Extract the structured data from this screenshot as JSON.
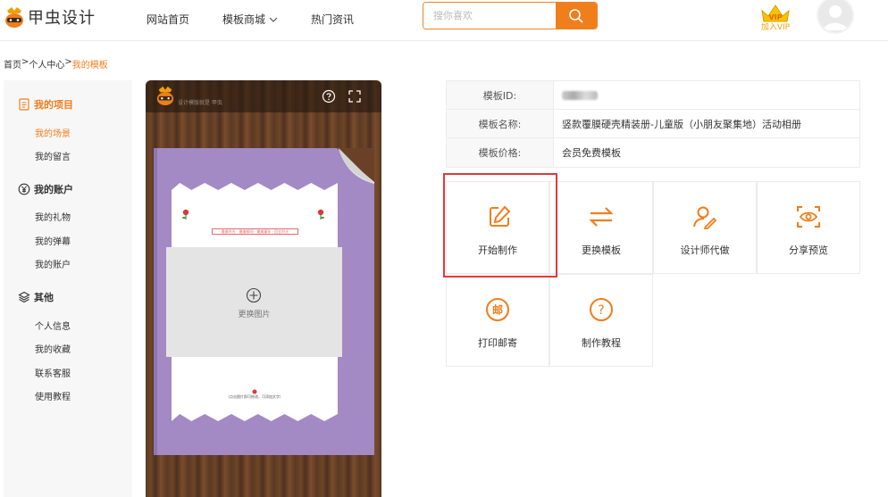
{
  "header": {
    "logo_text": "甲虫设计",
    "nav": [
      "网站首页",
      "模板商城",
      "热门资讯"
    ],
    "nav_dropdown_icon": "chevron-down-icon",
    "search_placeholder": "搜你喜欢",
    "vip_label": "加入VIP",
    "vip_badge_text": "VIP"
  },
  "breadcrumb": {
    "items": [
      "首页",
      "个人中心",
      "我的模板"
    ],
    "separator": ">"
  },
  "sidebar": {
    "groups": [
      {
        "title": "我的项目",
        "icon": "document-icon",
        "items": [
          "我的场景",
          "我的留言"
        ]
      },
      {
        "title": "我的账户",
        "icon": "yen-icon",
        "items": [
          "我的礼物",
          "我的弹幕",
          "我的账户"
        ]
      },
      {
        "title": "其他",
        "icon": "layers-icon",
        "items": [
          "个人信息",
          "我的收藏",
          "联系客服",
          "使用教程"
        ]
      }
    ]
  },
  "preview": {
    "subtitle": "设计模版就是 甲虫",
    "photo_label": "更换图片",
    "banner_text": "· 最美时光 · 最美瞬间 · 最美童年 · 回忆时光 ·",
    "bottom_note": "（点击图片即可修改，可添加文字）"
  },
  "info": {
    "rows": [
      {
        "key": "模板ID:",
        "value": ""
      },
      {
        "key": "模板名称:",
        "value": "竖款覆膜硬壳精装册-儿童版（小朋友聚集地）活动相册"
      },
      {
        "key": "模板价格:",
        "value": "会员免费模板"
      }
    ]
  },
  "actions": [
    {
      "label": "开始制作",
      "icon": "edit-icon"
    },
    {
      "label": "更换模板",
      "icon": "swap-icon"
    },
    {
      "label": "设计师代做",
      "icon": "designer-icon"
    },
    {
      "label": "分享预览",
      "icon": "eye-scan-icon"
    },
    {
      "label": "打印邮寄",
      "icon": "mail-icon",
      "icon_text": "邮"
    },
    {
      "label": "制作教程",
      "icon": "help-icon",
      "icon_text": "?"
    }
  ],
  "colors": {
    "accent": "#f07e1c",
    "highlight": "#e03a3a",
    "album": "#a38ac4"
  }
}
